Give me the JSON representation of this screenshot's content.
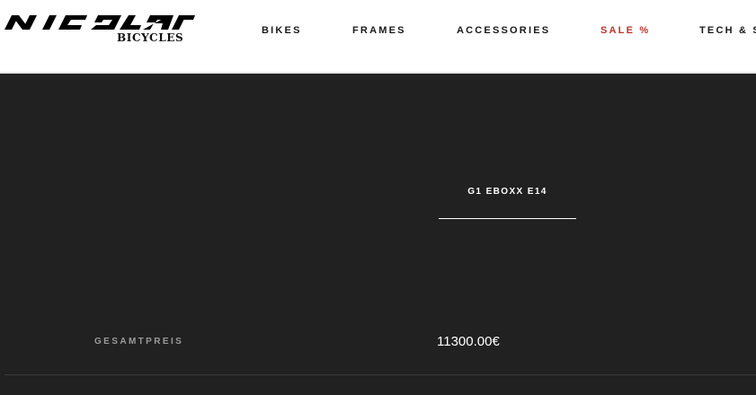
{
  "brand": {
    "logo_text": "NICOLAI",
    "subtitle": "BICYCLES"
  },
  "nav": {
    "items": [
      {
        "label": "BIKES"
      },
      {
        "label": "FRAMES"
      },
      {
        "label": "ACCESSORIES"
      },
      {
        "label": "SALE %"
      },
      {
        "label": "TECH & S"
      }
    ],
    "sale_color": "#c0342b"
  },
  "product": {
    "tab_label": "G1 EBOXX E14"
  },
  "summary": {
    "total_label": "GESAMTPREIS",
    "total_value": "11300.00€"
  },
  "theme": {
    "background": "#212121",
    "header_bg": "#ffffff"
  }
}
